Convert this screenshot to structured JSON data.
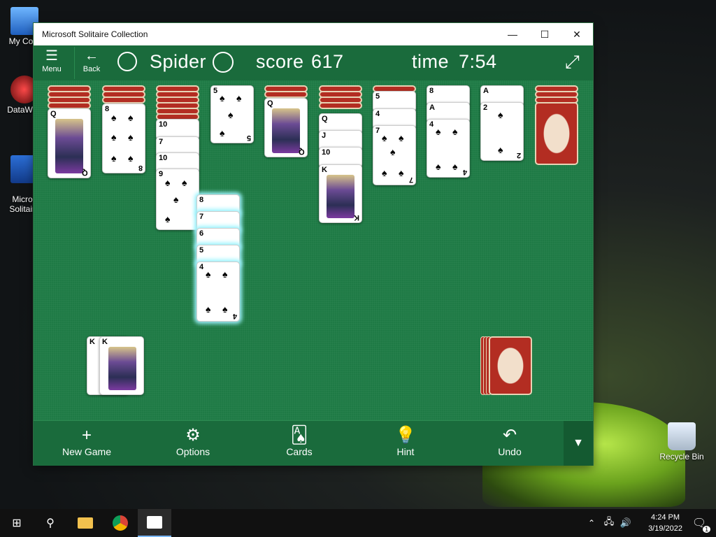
{
  "desktop": {
    "icons": [
      {
        "label": "My Com",
        "name": "my-computer-icon"
      },
      {
        "label": "DataWag",
        "name": "datawag-icon"
      },
      {
        "label": "Micros\nSolitaire",
        "name": "solitaire-shortcut-icon"
      },
      {
        "label": "Recycle Bin",
        "name": "recycle-bin-icon"
      }
    ]
  },
  "window": {
    "title": "Microsoft Solitaire Collection",
    "controls": {
      "minimize": "—",
      "maximize": "☐",
      "close": "✕"
    }
  },
  "header": {
    "menu_icon": "☰",
    "menu_label": "Menu",
    "back_icon": "←",
    "back_label": "Back",
    "game_name": "Spider",
    "score_label": "score",
    "score_value": "617",
    "time_label": "time",
    "time_value": "7:54",
    "fullscreen_icon": "⤢"
  },
  "tableau": {
    "pile1_top": "Q",
    "pile2_top": "8",
    "pile3": [
      "10",
      "7",
      "10",
      "9"
    ],
    "pile4_top": "5",
    "pile5_top": "Q",
    "pile6": [
      "Q",
      "J",
      "10",
      "K"
    ],
    "pile7": [
      "5",
      "4",
      "7"
    ],
    "pile8": [
      "8",
      "A",
      "4"
    ],
    "pile9": [
      "A",
      "2"
    ],
    "dragging": [
      "8",
      "7",
      "6",
      "5",
      "4"
    ],
    "completed": [
      "K",
      "K"
    ]
  },
  "suit": "♠",
  "toolbar": {
    "new_game_icon": "+",
    "new_game_label": "New Game",
    "options_icon": "⚙",
    "options_label": "Options",
    "cards_icon": "🂡",
    "cards_label": "Cards",
    "hint_icon": "💡",
    "hint_label": "Hint",
    "undo_icon": "↶",
    "undo_label": "Undo",
    "collapse_icon": "▼"
  },
  "taskbar": {
    "start_icon": "⊞",
    "search_icon": "⚲",
    "time": "4:24 PM",
    "date": "3/19/2022",
    "notification_count": "1"
  },
  "colors": {
    "felt": "#1e7a45",
    "bar": "#1a6b3c",
    "card_back": "#b32d22",
    "glow": "#9ff6ff"
  }
}
